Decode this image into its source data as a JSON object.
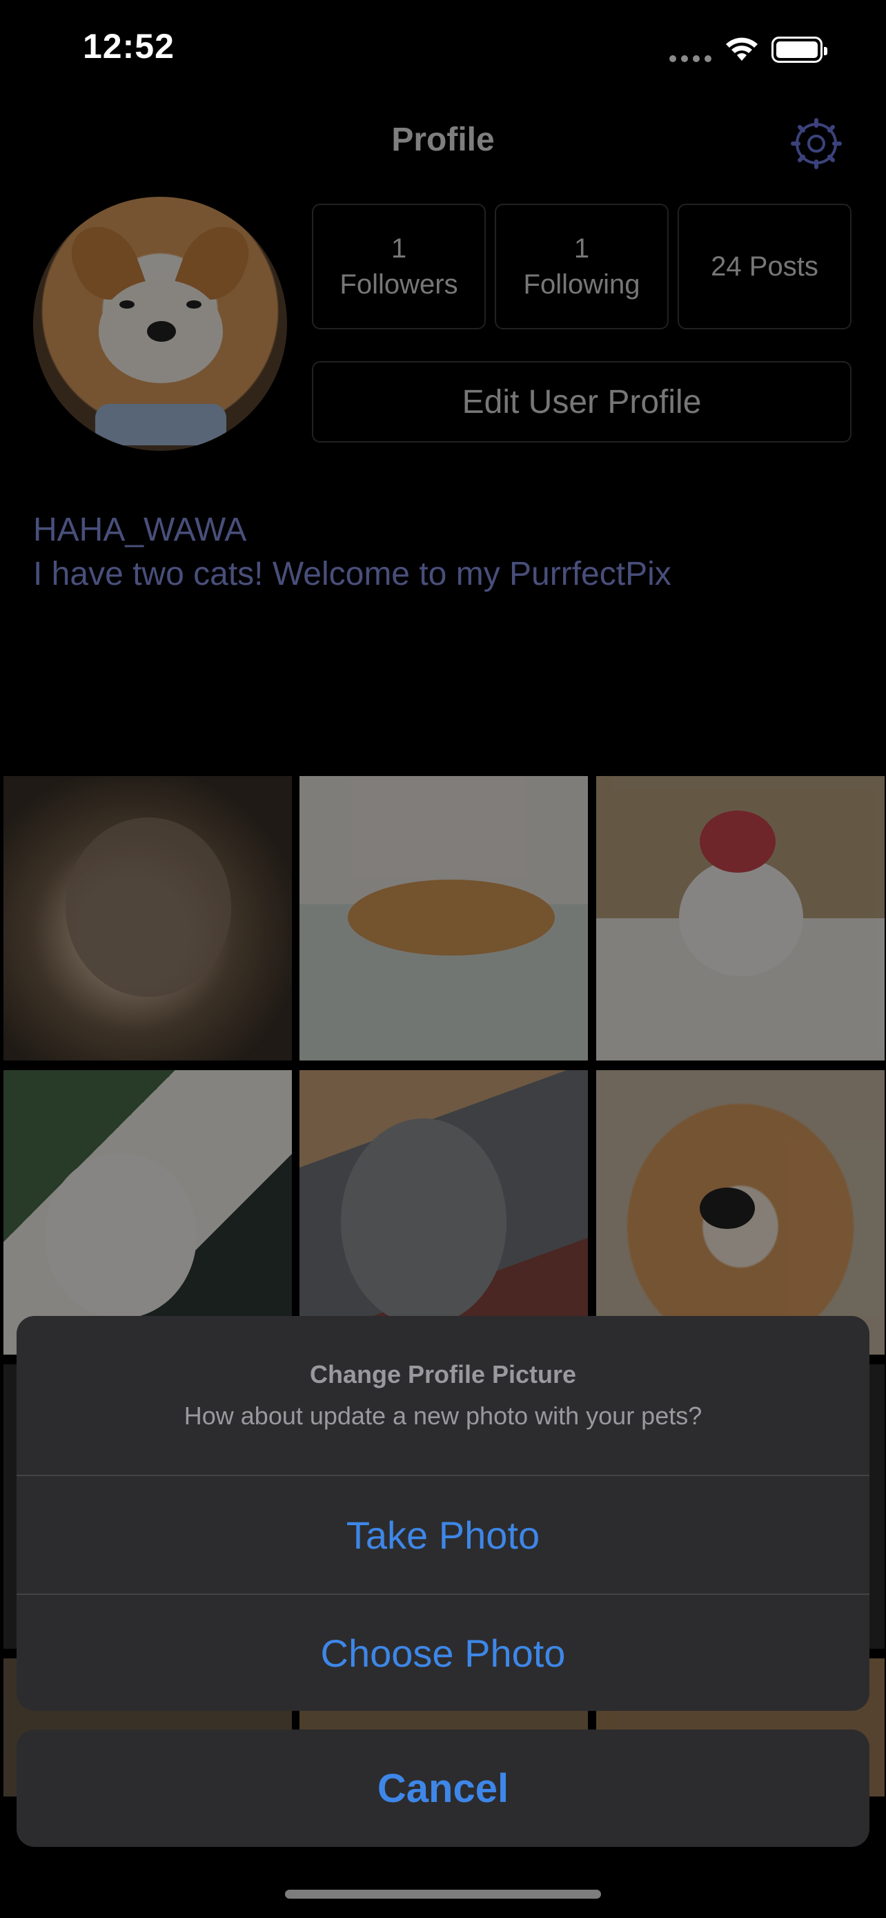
{
  "status_bar": {
    "time": "12:52"
  },
  "header": {
    "title": "Profile",
    "settings_icon": "gear-icon"
  },
  "profile": {
    "stats": [
      {
        "count": "1",
        "label": "Followers"
      },
      {
        "count": "1",
        "label": "Following"
      },
      {
        "text": "24 Posts"
      }
    ],
    "edit_button": "Edit User Profile",
    "username": "HAHA_WAWA",
    "bio": "I have two cats! Welcome to my PurrfectPix"
  },
  "action_sheet": {
    "title": "Change Profile Picture",
    "message": "How about update a new photo with your pets?",
    "actions": [
      "Take Photo",
      "Choose Photo"
    ],
    "cancel": "Cancel",
    "accent_color": "#3e87e8"
  }
}
